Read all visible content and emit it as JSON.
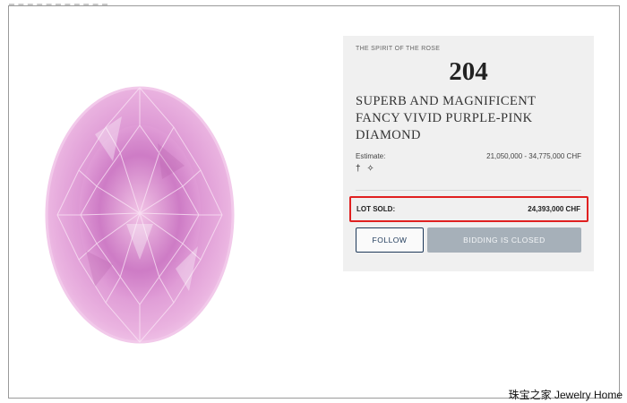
{
  "panel": {
    "supertitle": "THE SPIRIT OF THE ROSE",
    "lot_number": "204",
    "title": "SUPERB AND MAGNIFICENT FANCY VIVID PURPLE-PINK DIAMOND",
    "estimate_label": "Estimate:",
    "estimate_value": "21,050,000 - 34,775,000 CHF",
    "symbols": "† ✧",
    "lot_sold_label": "LOT SOLD:",
    "lot_sold_value": "24,393,000 CHF",
    "highlight_color": "#e02020"
  },
  "buttons": {
    "follow_label": "FOLLOW",
    "bidding_label": "BIDDING IS CLOSED"
  },
  "image": {
    "subject": "oval-cut purple-pink diamond"
  },
  "watermark": "珠宝之家 Jewelry Home"
}
